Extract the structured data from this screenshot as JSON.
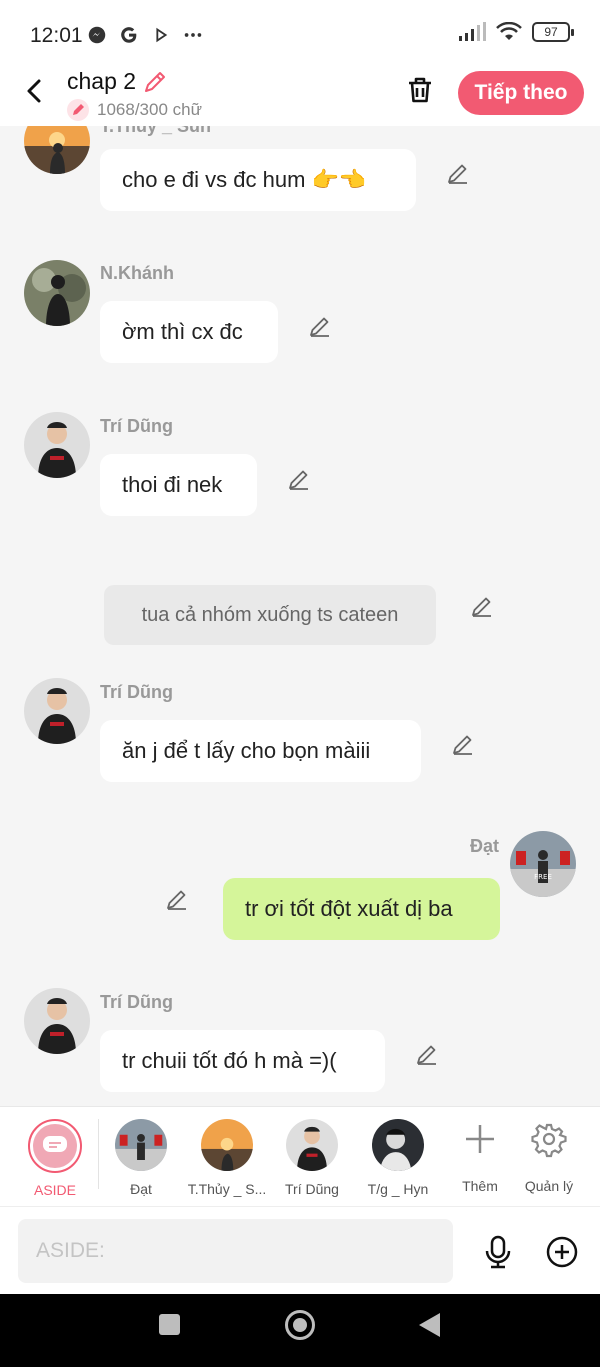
{
  "status": {
    "time": "12:01",
    "battery": "97"
  },
  "header": {
    "title": "chap 2",
    "word_count": "1068/300 chữ",
    "next_label": "Tiếp theo"
  },
  "messages": [
    {
      "type": "char",
      "name": "T.Thủy _ Sun",
      "text": "cho e đi vs đc hum 👉👈"
    },
    {
      "type": "char",
      "name": "N.Khánh",
      "text": "ờm thì cx đc"
    },
    {
      "type": "char",
      "name": "Trí Dũng",
      "text": "thoi đi nek"
    },
    {
      "type": "narration",
      "text": "tua cả nhóm xuống ts cateen"
    },
    {
      "type": "char",
      "name": "Trí Dũng",
      "text": "ăn j để t lấy cho bọn màiii"
    },
    {
      "type": "me",
      "name": "Đạt",
      "text": "tr ơi tốt đột xuất dị ba"
    },
    {
      "type": "char",
      "name": "Trí Dũng",
      "text": "tr chuii tốt đó h mà =)("
    }
  ],
  "characters": [
    {
      "label": "ASIDE"
    },
    {
      "label": "Đạt"
    },
    {
      "label": "T.Thủy _ S..."
    },
    {
      "label": "Trí Dũng"
    },
    {
      "label": "T/g _ Hyn"
    },
    {
      "label": "Thêm"
    },
    {
      "label": "Quản lý"
    }
  ],
  "input": {
    "placeholder": "ASIDE:"
  },
  "colors": {
    "accent": "#f25a72",
    "my_bubble": "#d5f59a",
    "narration_bg": "#e9e9e9"
  }
}
